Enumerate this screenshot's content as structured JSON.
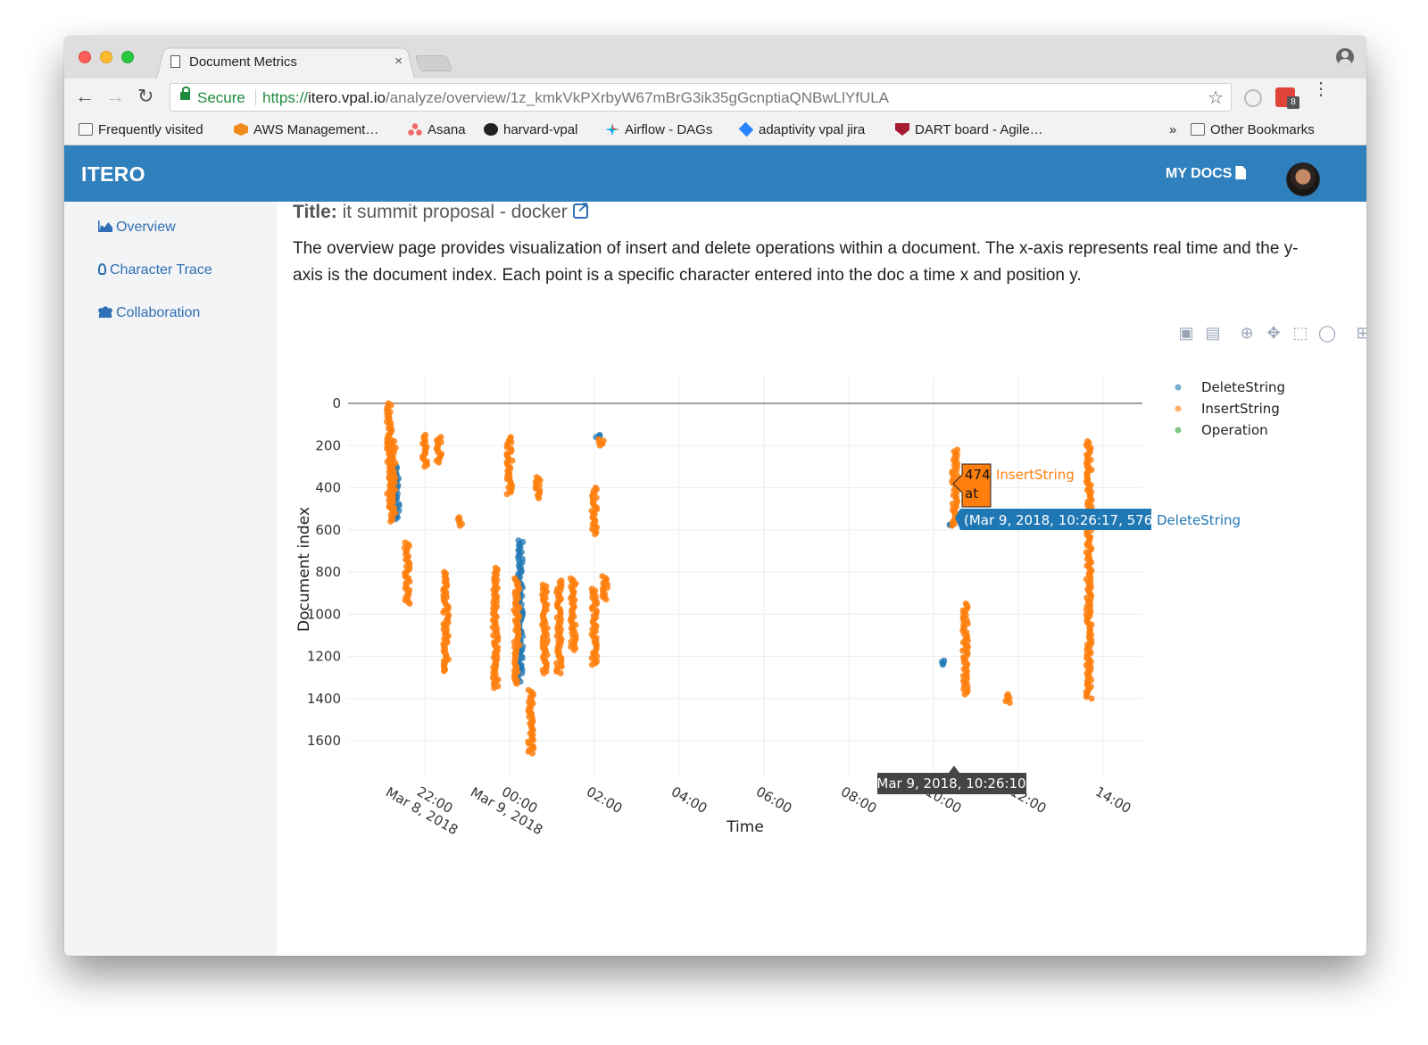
{
  "browser": {
    "tab_title": "Document Metrics",
    "tab_close": "×",
    "secure_label": "Secure",
    "url_scheme": "https://",
    "url_domain": "itero.vpal.io",
    "url_path": "/analyze/overview/1z_kmkVkPXrbyW67mBrG3ik35gGcnptiaQNBwLlYfULA",
    "ext_badge": "8",
    "bookmarks": [
      {
        "label": "Frequently visited",
        "icon": "folder-icon"
      },
      {
        "label": "AWS Management…",
        "icon": "aws-icon"
      },
      {
        "label": "Asana",
        "icon": "asana-icon"
      },
      {
        "label": "harvard-vpal",
        "icon": "github-icon"
      },
      {
        "label": "Airflow - DAGs",
        "icon": "airflow-icon"
      },
      {
        "label": "adaptivity vpal jira",
        "icon": "jira-icon"
      },
      {
        "label": "DART board - Agile…",
        "icon": "dart-icon"
      }
    ],
    "bookmarks_overflow": "»",
    "other_bookmarks": "Other Bookmarks"
  },
  "app": {
    "brand": "ITERO",
    "my_docs": "MY DOCS",
    "sidebar": [
      {
        "label": "Overview",
        "icon": "area-chart-icon"
      },
      {
        "label": "Character Trace",
        "icon": "lightbulb-icon"
      },
      {
        "label": "Collaboration",
        "icon": "users-icon"
      }
    ],
    "title_label": "Title:",
    "doc_title": "it summit proposal - docker",
    "description": "The overview page provides visualization of insert and delete operations within a document. The x-axis represents real time and the y-axis is the document index. Each point is a specific character entered into the doc a time x and position y."
  },
  "colors": {
    "header_blue": "#3080bd",
    "link_blue": "#2f6fb3",
    "insert_orange": "#ff7f0e",
    "delete_blue": "#1f77b4",
    "operation_green": "#2ca02c"
  },
  "chart_data": {
    "type": "scatter",
    "xlabel": "Time",
    "ylabel": "Document index",
    "y_reversed": true,
    "ylim": [
      0,
      1700
    ],
    "y_ticks": [
      "0",
      "200",
      "400",
      "600",
      "800",
      "1000",
      "1200",
      "1400",
      "1600"
    ],
    "x_ticks": [
      {
        "line1": "22:00",
        "line2": "Mar 8, 2018"
      },
      {
        "line1": "00:00",
        "line2": "Mar 9, 2018"
      },
      {
        "line1": "02:00",
        "line2": ""
      },
      {
        "line1": "04:00",
        "line2": ""
      },
      {
        "line1": "06:00",
        "line2": ""
      },
      {
        "line1": "08:00",
        "line2": ""
      },
      {
        "line1": "10:00",
        "line2": ""
      },
      {
        "line1": "12:00",
        "line2": ""
      },
      {
        "line1": "14:00",
        "line2": ""
      }
    ],
    "legend": [
      "DeleteString",
      "InsertString",
      "Operation"
    ],
    "legend_position": "top-right",
    "series": [
      {
        "name": "InsertString",
        "clusters": [
          {
            "x": "2018-03-08T21:10",
            "y": [
              0,
              500
            ]
          },
          {
            "x": "2018-03-08T21:15",
            "y": [
              180,
              560
            ]
          },
          {
            "x": "2018-03-08T21:35",
            "y": [
              660,
              950
            ]
          },
          {
            "x": "2018-03-08T22:00",
            "y": [
              150,
              300
            ]
          },
          {
            "x": "2018-03-08T22:20",
            "y": [
              160,
              280
            ]
          },
          {
            "x": "2018-03-08T22:30",
            "y": [
              800,
              1270
            ]
          },
          {
            "x": "2018-03-08T22:50",
            "y": [
              540,
              580
            ]
          },
          {
            "x": "2018-03-08T23:40",
            "y": [
              780,
              1350
            ]
          },
          {
            "x": "2018-03-09T00:00",
            "y": [
              160,
              430
            ]
          },
          {
            "x": "2018-03-09T00:10",
            "y": [
              830,
              1330
            ]
          },
          {
            "x": "2018-03-09T00:30",
            "y": [
              1360,
              1660
            ]
          },
          {
            "x": "2018-03-09T00:40",
            "y": [
              350,
              450
            ]
          },
          {
            "x": "2018-03-09T00:50",
            "y": [
              860,
              1280
            ]
          },
          {
            "x": "2018-03-09T01:10",
            "y": [
              840,
              1280
            ]
          },
          {
            "x": "2018-03-09T01:30",
            "y": [
              830,
              1170
            ]
          },
          {
            "x": "2018-03-09T02:00",
            "y": [
              400,
              620
            ]
          },
          {
            "x": "2018-03-09T02:00",
            "y": [
              880,
              1240
            ]
          },
          {
            "x": "2018-03-09T02:15",
            "y": [
              820,
              930
            ]
          },
          {
            "x": "2018-03-09T02:10",
            "y": [
              170,
              200
            ]
          },
          {
            "x": "2018-03-09T10:30",
            "y": [
              220,
              580
            ]
          },
          {
            "x": "2018-03-09T10:45",
            "y": [
              950,
              1380
            ]
          },
          {
            "x": "2018-03-09T11:45",
            "y": [
              1380,
              1420
            ]
          },
          {
            "x": "2018-03-09T13:40",
            "y": [
              180,
              1400
            ]
          }
        ]
      },
      {
        "name": "DeleteString",
        "clusters": [
          {
            "x": "2018-03-08T21:20",
            "y": [
              300,
              550
            ]
          },
          {
            "x": "2018-03-09T00:15",
            "y": [
              650,
              1320
            ]
          },
          {
            "x": "2018-03-09T02:05",
            "y": [
              150,
              160
            ]
          },
          {
            "x": "2018-03-09T10:26",
            "y": [
              576,
              576
            ]
          },
          {
            "x": "2018-03-09T10:15",
            "y": [
              1220,
              1240
            ]
          }
        ]
      },
      {
        "name": "Operation",
        "clusters": []
      }
    ],
    "hover": {
      "insert_value": "474",
      "insert_at": "at",
      "insert_name": "InsertString",
      "delete_label": "(Mar 9, 2018, 10:26:17, 576)",
      "delete_name": "DeleteString",
      "x_label": "Mar 9, 2018, 10:26:10"
    }
  }
}
